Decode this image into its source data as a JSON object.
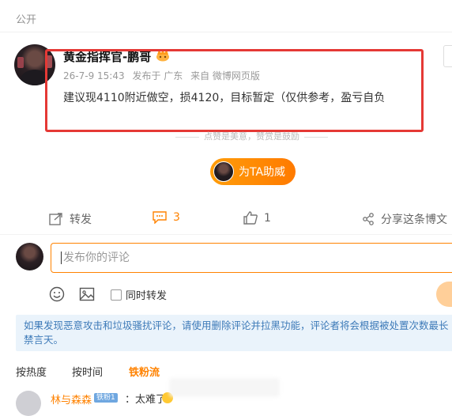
{
  "visibility_label": "公开",
  "post": {
    "author_name": "黄金指挥官-鹏哥",
    "time": "26-7-9 15:43",
    "location": "发布于 广东",
    "source": "来自 微博网页版",
    "content": "建议现4110附近做空，损4120，目标暂定（仅供参考，盈亏自负",
    "reward_hint": "点赞是美意，赞赏是鼓励",
    "support_button": "为TA助威"
  },
  "actions": {
    "repost": "转发",
    "comment_count": "3",
    "like_count": "1",
    "share": "分享这条博文"
  },
  "comment_box": {
    "placeholder": "发布你的评论",
    "repost_checkbox": "同时转发"
  },
  "notice": "如果发现恶意攻击和垃圾骚扰评论，请使用删除评论并拉黑功能，评论者将会根据被处置次数最长禁言天。",
  "sort_tabs": [
    "按热度",
    "按时间",
    "铁粉流"
  ],
  "first_comment": {
    "name": "林与森森",
    "badge": "铁粉1",
    "text": "：太难了"
  },
  "colors": {
    "accent": "#ff8200",
    "highlight_box": "#e53935",
    "notice_bg": "#eaf3fb",
    "notice_text": "#3d7ab8"
  }
}
